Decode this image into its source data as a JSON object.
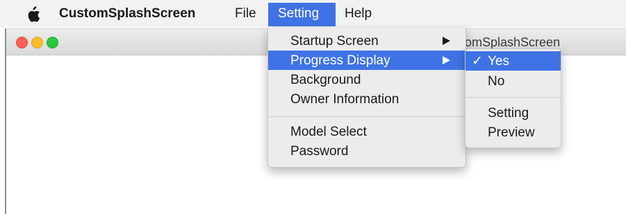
{
  "menubar": {
    "apple_icon": "apple-logo-icon",
    "app_name": "CustomSplashScreen",
    "menus": [
      "File",
      "Setting",
      "Help"
    ],
    "active_menu": "Setting",
    "accent_color": "#3f73e5"
  },
  "window": {
    "title": "tomSplashScreen",
    "traffic_lights": {
      "close_color": "#fc5f57",
      "minimize_color": "#fdbc2e",
      "maximize_color": "#28c840"
    }
  },
  "setting_menu": {
    "items": [
      {
        "label": "Startup Screen",
        "has_submenu": true
      },
      {
        "label": "Progress Display",
        "has_submenu": true,
        "highlighted": true
      },
      {
        "label": "Background",
        "has_submenu": false
      },
      {
        "label": "Owner Information",
        "has_submenu": false
      },
      {
        "label": "Model Select",
        "has_submenu": false
      },
      {
        "label": "Password",
        "has_submenu": false
      }
    ]
  },
  "progress_submenu": {
    "checkmark": "✓",
    "items": [
      {
        "label": "Yes",
        "checked": true,
        "highlighted": true
      },
      {
        "label": "No",
        "checked": false
      },
      {
        "label": "Setting",
        "checked": false
      },
      {
        "label": "Preview",
        "checked": false
      }
    ]
  }
}
